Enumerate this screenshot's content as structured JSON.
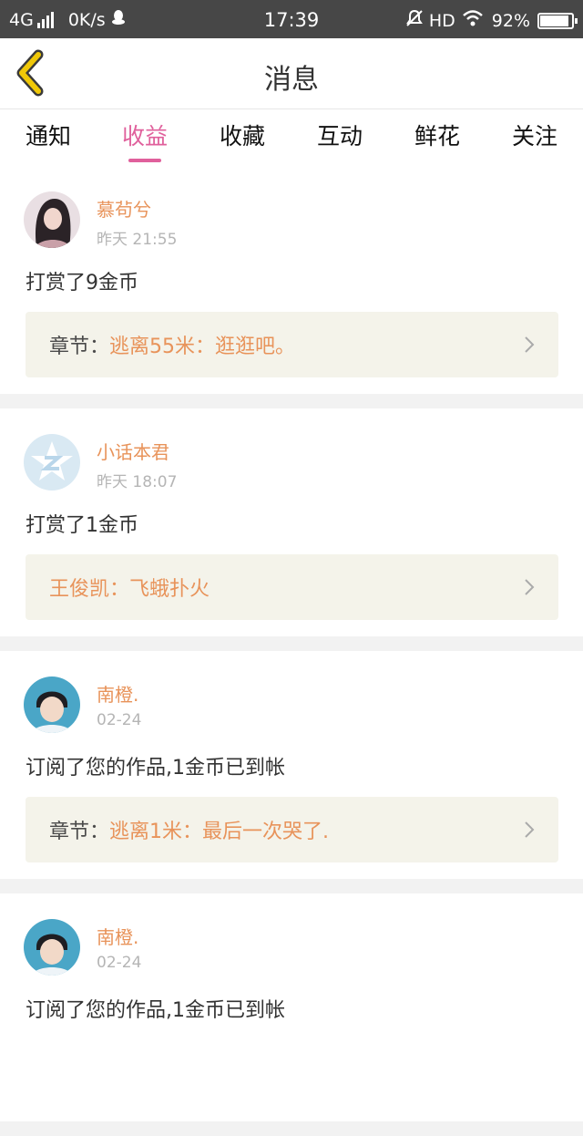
{
  "status_bar": {
    "network": "4G",
    "speed": "0K/s",
    "time": "17:39",
    "hd": "HD",
    "battery": "92%",
    "battery_level": 0.92,
    "icons": [
      "signal-icon",
      "qq-icon",
      "mute-icon",
      "wifi-icon",
      "battery-icon"
    ]
  },
  "header": {
    "title": "消息",
    "back_icon": "chevron-left-icon",
    "back_color": "#f0c808"
  },
  "tabs": [
    {
      "label": "通知",
      "active": false
    },
    {
      "label": "收益",
      "active": true
    },
    {
      "label": "收藏",
      "active": false
    },
    {
      "label": "互动",
      "active": false
    },
    {
      "label": "鲜花",
      "active": false
    },
    {
      "label": "关注",
      "active": false
    }
  ],
  "colors": {
    "accent": "#e0609c",
    "name": "#e8935a",
    "quote_bg": "#f4f3ea"
  },
  "messages": [
    {
      "user": "慕茍兮",
      "date": "昨天 21:55",
      "action": "打赏了9金币",
      "quote_prefix": "章节：",
      "quote_text": "逃离55米：逛逛吧。"
    },
    {
      "user": "小话本君",
      "date": "昨天 18:07",
      "action": "打赏了1金币",
      "quote_prefix": "",
      "quote_text": "王俊凯：飞蛾扑火"
    },
    {
      "user": "南橙.",
      "date": "02-24",
      "action": "订阅了您的作品,1金币已到帐",
      "quote_prefix": "章节：",
      "quote_text": "逃离1米：最后一次哭了."
    },
    {
      "user": "南橙.",
      "date": "02-24",
      "action": "订阅了您的作品,1金币已到帐"
    }
  ]
}
